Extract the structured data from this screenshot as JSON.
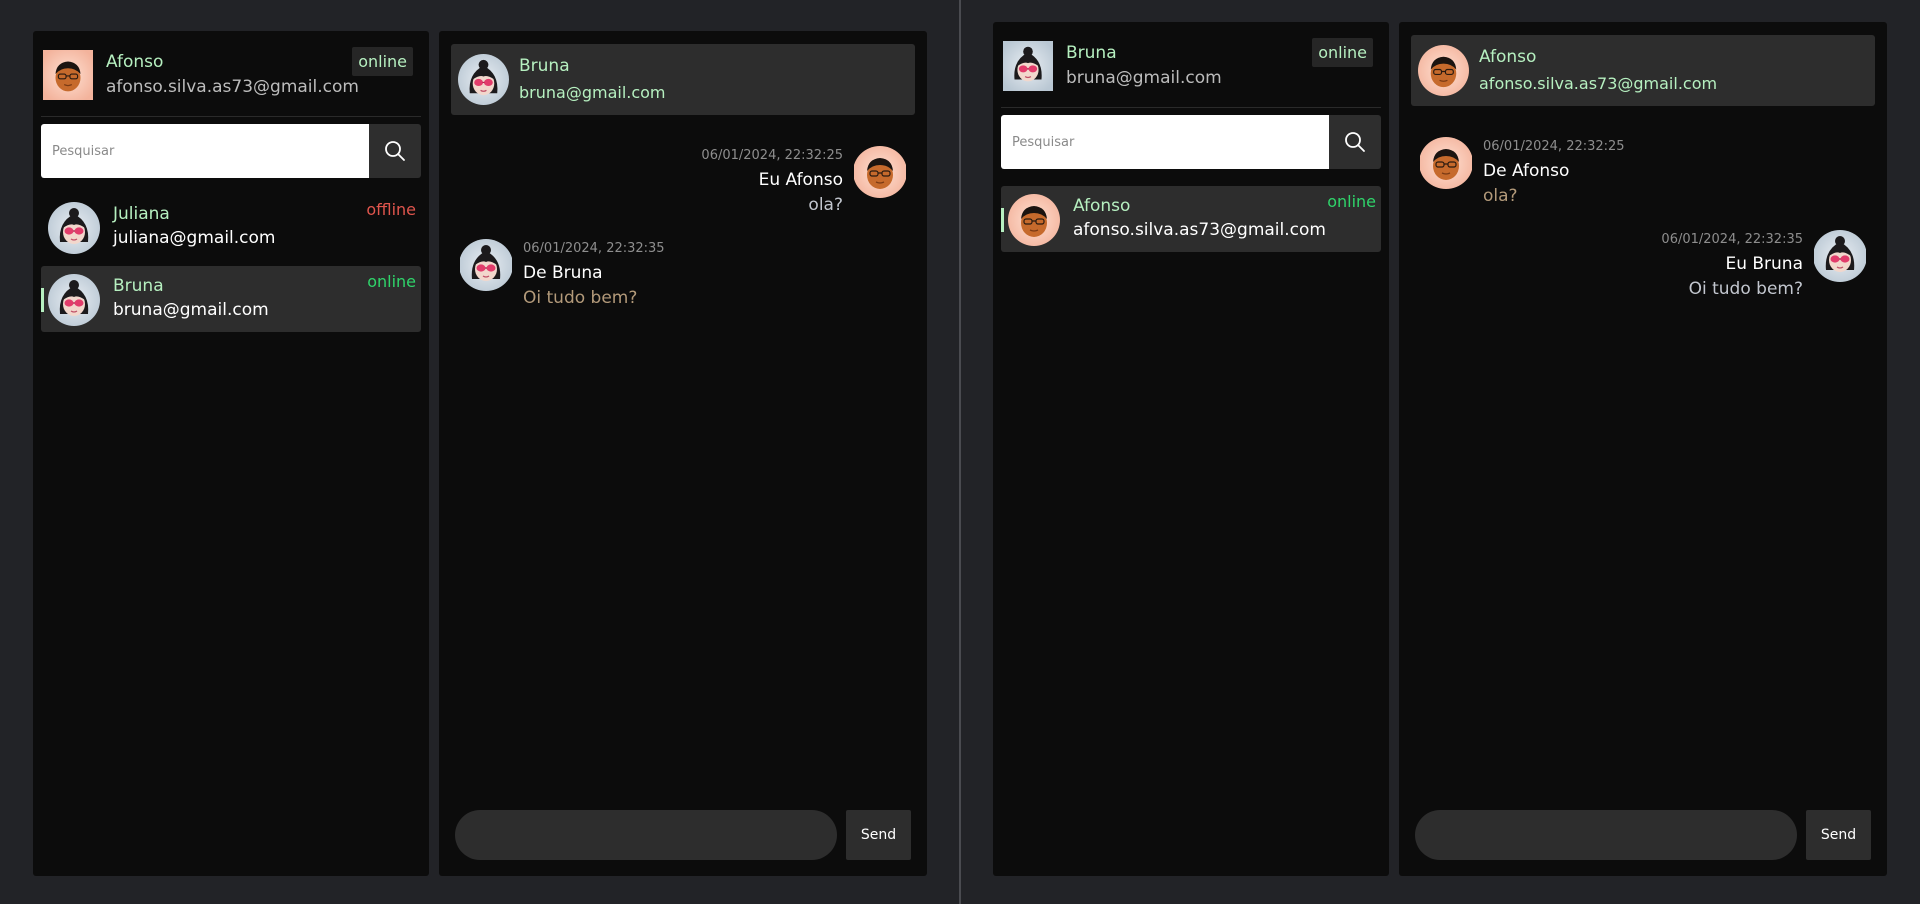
{
  "colors": {
    "online": "#2fd46a",
    "offline": "#e0554d",
    "accent_green": "#b6f0c0",
    "received_text": "#b39a7a",
    "sent_text": "#c2c6ce"
  },
  "left": {
    "me": {
      "name": "Afonso",
      "email": "afonso.silva.as73@gmail.com",
      "status": "online",
      "avatar": "boy-avatar"
    },
    "search": {
      "placeholder": "Pesquisar",
      "icon": "search-icon"
    },
    "contacts": [
      {
        "name": "Juliana",
        "email": "juliana@gmail.com",
        "status": "offline",
        "avatar": "girl-avatar"
      },
      {
        "name": "Bruna",
        "email": "bruna@gmail.com",
        "status": "online",
        "avatar": "girl-avatar"
      }
    ],
    "chat": {
      "header": {
        "name": "Bruna",
        "email": "bruna@gmail.com"
      },
      "messages": [
        {
          "time": "06/01/2024, 22:32:25",
          "from": "Eu Afonso",
          "text": "ola?",
          "side": "sent"
        },
        {
          "time": "06/01/2024, 22:32:35",
          "from": "De Bruna",
          "text": "Oi tudo bem?",
          "side": "received"
        }
      ],
      "send_label": "Send"
    }
  },
  "right": {
    "me": {
      "name": "Bruna",
      "email": "bruna@gmail.com",
      "status": "online",
      "avatar": "girl-avatar"
    },
    "search": {
      "placeholder": "Pesquisar",
      "icon": "search-icon"
    },
    "contacts": [
      {
        "name": "Afonso",
        "email": "afonso.silva.as73@gmail.com",
        "status": "online",
        "avatar": "boy-avatar"
      }
    ],
    "chat": {
      "header": {
        "name": "Afonso",
        "email": "afonso.silva.as73@gmail.com"
      },
      "messages": [
        {
          "time": "06/01/2024, 22:32:25",
          "from": "De Afonso",
          "text": "ola?",
          "side": "received"
        },
        {
          "time": "06/01/2024, 22:32:35",
          "from": "Eu Bruna",
          "text": "Oi tudo bem?",
          "side": "sent"
        }
      ],
      "send_label": "Send"
    }
  }
}
